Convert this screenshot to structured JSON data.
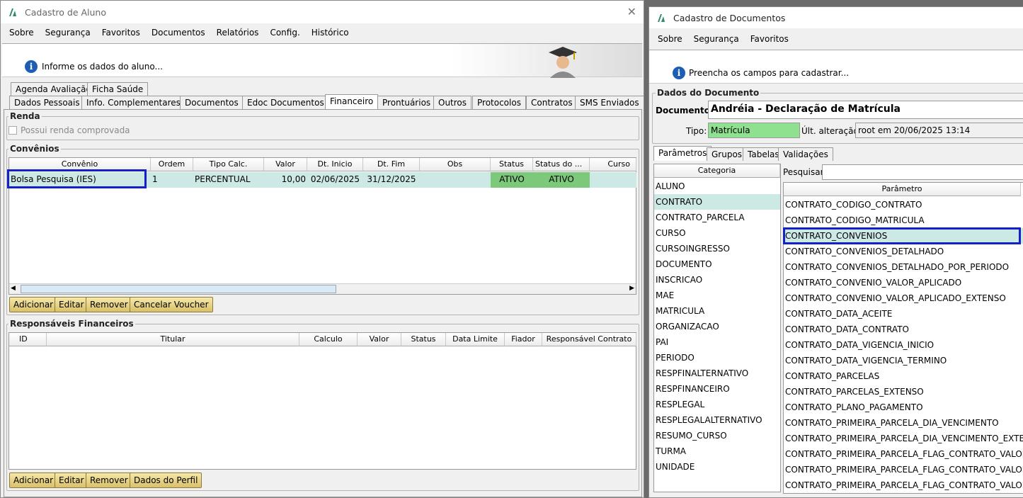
{
  "w1": {
    "title": "Cadastro de Aluno",
    "menu": [
      "Sobre",
      "Segurança",
      "Favoritos",
      "Documentos",
      "Relatórios",
      "Config.",
      "Histórico"
    ],
    "banner": "Informe os dados do aluno...",
    "tabs_row1": [
      "Agenda Avaliação",
      "Ficha Saúde"
    ],
    "tabs_row2": [
      "Dados Pessoais",
      "Info. Complementares",
      "Documentos",
      "Edoc Documentos",
      "Financeiro",
      "Prontuários",
      "Outros",
      "Protocolos",
      "Contratos",
      "SMS Enviados"
    ],
    "renda": {
      "title": "Renda",
      "checkbox": "Possui renda comprovada"
    },
    "convenios": {
      "title": "Convênios",
      "columns": [
        "Convênio",
        "Ordem",
        "Tipo Calc.",
        "Valor",
        "Dt. Inicio",
        "Dt. Fim",
        "Obs",
        "Status",
        "Status do ...",
        "Curso"
      ],
      "rows": [
        [
          "Bolsa Pesquisa (IES)",
          "1",
          "PERCENTUAL",
          "10,00",
          "02/06/2025",
          "31/12/2025",
          "",
          "ATIVO",
          "ATIVO",
          ""
        ]
      ],
      "buttons": [
        "Adicionar",
        "Editar",
        "Remover",
        "Cancelar Voucher"
      ]
    },
    "responsaveis": {
      "title": "Responsáveis Financeiros",
      "columns": [
        "ID",
        "Titular",
        "Calculo",
        "Valor",
        "Status",
        "Data Limite",
        "Fiador",
        "Responsável Contrato"
      ],
      "buttons": [
        "Adicionar",
        "Editar",
        "Remover",
        "Dados do Perfil"
      ]
    }
  },
  "w2": {
    "title": "Cadastro de Documentos",
    "menu": [
      "Sobre",
      "Segurança",
      "Favoritos"
    ],
    "banner": "Preencha os campos para cadastrar...",
    "dados_title": "Dados do Documento",
    "documento_label": "Documento:",
    "documento_value": "Andréia - Declaração de Matrícula",
    "tipo_label": "Tipo:",
    "tipo_value": "Matrícula",
    "ult_label": "Últ. alteração:",
    "ult_value": "root em 20/06/2025 13:14",
    "tabs": [
      "Parâmetros",
      "Grupos",
      "Tabelas",
      "Validações"
    ],
    "categoria_header": "Categoria",
    "categorias": [
      "ALUNO",
      "CONTRATO",
      "CONTRATO_PARCELA",
      "CURSO",
      "CURSOINGRESSO",
      "DOCUMENTO",
      "INSCRICAO",
      "MAE",
      "MATRICULA",
      "ORGANIZACAO",
      "PAI",
      "PERIODO",
      "RESPFINALTERNATIVO",
      "RESPFINANCEIRO",
      "RESPLEGAL",
      "RESPLEGALALTERNATIVO",
      "RESUMO_CURSO",
      "TURMA",
      "UNIDADE"
    ],
    "pesquisar_label": "Pesquisar:",
    "parametro_header": "Parâmetro",
    "parametros": [
      "CONTRATO_CODIGO_CONTRATO",
      "CONTRATO_CODIGO_MATRICULA",
      "CONTRATO_CONVENIOS",
      "CONTRATO_CONVENIOS_DETALHADO",
      "CONTRATO_CONVENIOS_DETALHADO_POR_PERIODO",
      "CONTRATO_CONVENIO_VALOR_APLICADO",
      "CONTRATO_CONVENIO_VALOR_APLICADO_EXTENSO",
      "CONTRATO_DATA_ACEITE",
      "CONTRATO_DATA_CONTRATO",
      "CONTRATO_DATA_VIGENCIA_INICIO",
      "CONTRATO_DATA_VIGENCIA_TERMINO",
      "CONTRATO_PARCELAS",
      "CONTRATO_PARCELAS_EXTENSO",
      "CONTRATO_PLANO_PAGAMENTO",
      "CONTRATO_PRIMEIRA_PARCELA_DIA_VENCIMENTO",
      "CONTRATO_PRIMEIRA_PARCELA_DIA_VENCIMENTO_EXTENSO",
      "CONTRATO_PRIMEIRA_PARCELA_FLAG_CONTRATO_VALOR",
      "CONTRATO_PRIMEIRA_PARCELA_FLAG_CONTRATO_VALOR_...",
      "CONTRATO_PRIMEIRA_PARCELA_FLAG_CONTRATO_VALOR_..."
    ]
  },
  "colors": {
    "highlight": "#cde9e6",
    "status_green": "#7cc97c",
    "tipo_green": "#8fe08f",
    "selection_box": "#1420c8"
  }
}
